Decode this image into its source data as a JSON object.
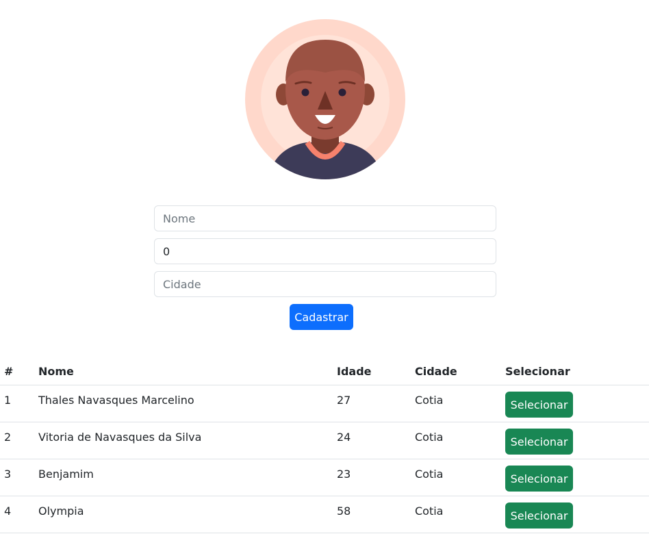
{
  "colors": {
    "primary_button": "#0d6efd",
    "success_button": "#198754",
    "border": "#dee2e6"
  },
  "avatar": {
    "icon": "person-avatar-icon"
  },
  "form": {
    "nome_placeholder": "Nome",
    "nome_value": "",
    "idade_value": "0",
    "cidade_placeholder": "Cidade",
    "cidade_value": "",
    "submit_label": "Cadastrar"
  },
  "table": {
    "headers": [
      "#",
      "Nome",
      "Idade",
      "Cidade",
      "Selecionar"
    ],
    "rows": [
      {
        "id": "1",
        "nome": "Thales Navasques Marcelino",
        "idade": "27",
        "cidade": "Cotia",
        "action": "Selecionar"
      },
      {
        "id": "2",
        "nome": "Vitoria de Navasques da Silva",
        "idade": "24",
        "cidade": "Cotia",
        "action": "Selecionar"
      },
      {
        "id": "3",
        "nome": "Benjamim",
        "idade": "23",
        "cidade": "Cotia",
        "action": "Selecionar"
      },
      {
        "id": "4",
        "nome": "Olympia",
        "idade": "58",
        "cidade": "Cotia",
        "action": "Selecionar"
      }
    ]
  }
}
